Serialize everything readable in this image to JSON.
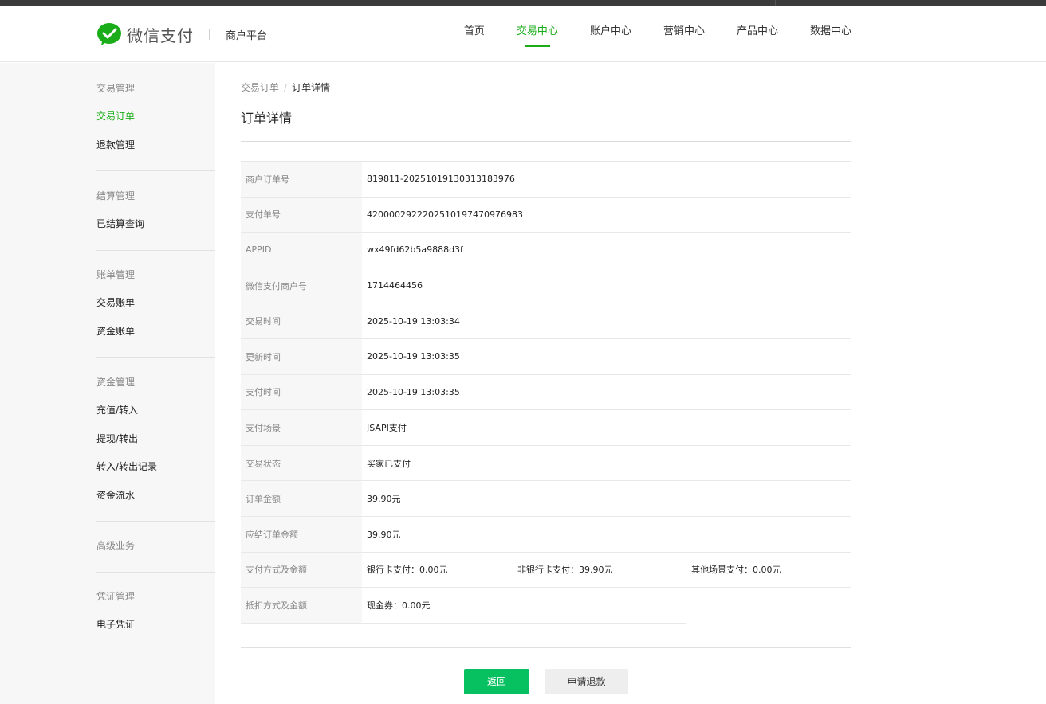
{
  "header": {
    "logo_text": "微信支付",
    "platform": "商户平台",
    "brand_color": "#1aad19",
    "nav": [
      {
        "label": "首页",
        "active": false
      },
      {
        "label": "交易中心",
        "active": true
      },
      {
        "label": "账户中心",
        "active": false
      },
      {
        "label": "营销中心",
        "active": false
      },
      {
        "label": "产品中心",
        "active": false
      },
      {
        "label": "数据中心",
        "active": false
      }
    ]
  },
  "sidebar": {
    "groups": [
      {
        "title": "交易管理",
        "items": [
          "交易订单",
          "退款管理"
        ]
      },
      {
        "title": "结算管理",
        "items": [
          "已结算查询"
        ]
      },
      {
        "title": "账单管理",
        "items": [
          "交易账单",
          "资金账单"
        ]
      },
      {
        "title": "资金管理",
        "items": [
          "充值/转入",
          "提现/转出",
          "转入/转出记录",
          "资金流水"
        ]
      },
      {
        "title": "高级业务",
        "items": []
      },
      {
        "title": "凭证管理",
        "items": [
          "电子凭证"
        ]
      }
    ],
    "active_item": "交易订单"
  },
  "breadcrumb": {
    "parent": "交易订单",
    "current": "订单详情"
  },
  "page_title": "订单详情",
  "details": [
    {
      "label": "商户订单号",
      "value": "819811-20251019130313183976"
    },
    {
      "label": "支付单号",
      "value": "4200002922202510197470976983"
    },
    {
      "label": "APPID",
      "value": "wx49fd62b5a9888d3f"
    },
    {
      "label": "微信支付商户号",
      "value": "1714464456"
    },
    {
      "label": "交易时间",
      "value": "2025-10-19 13:03:34"
    },
    {
      "label": "更新时间",
      "value": "2025-10-19 13:03:35"
    },
    {
      "label": "支付时间",
      "value": "2025-10-19 13:03:35"
    },
    {
      "label": "支付场景",
      "value": "JSAPI支付"
    },
    {
      "label": "交易状态",
      "value": "买家已支付"
    },
    {
      "label": "订单金额",
      "value": "39.90元"
    },
    {
      "label": "应结订单金额",
      "value": "39.90元"
    },
    {
      "label": "支付方式及金额",
      "values": [
        "银行卡支付：0.00元",
        "非银行卡支付：39.90元",
        "其他场景支付：0.00元"
      ]
    },
    {
      "label": "抵扣方式及金额",
      "value": "现金券：0.00元"
    }
  ],
  "buttons": {
    "back": "返回",
    "refund": "申请退款"
  }
}
